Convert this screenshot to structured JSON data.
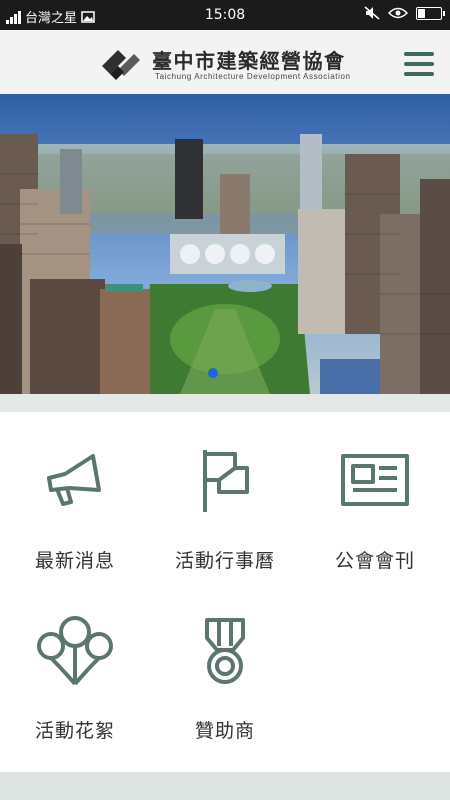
{
  "status_bar": {
    "carrier": "台灣之星",
    "time": "15:08"
  },
  "header": {
    "title_zh": "臺中市建築經營協會",
    "title_en": "Taichung Architecture Development Association",
    "accent_color": "#3f6b5f"
  },
  "hero": {
    "active_slide": 1,
    "indicator_color": "#1e63e0"
  },
  "menu": {
    "items": [
      {
        "label": "最新消息",
        "icon": "megaphone-icon"
      },
      {
        "label": "活動行事曆",
        "icon": "flag-icon"
      },
      {
        "label": "公會會刊",
        "icon": "newspaper-icon"
      },
      {
        "label": "活動花絮",
        "icon": "balloons-icon"
      },
      {
        "label": "贊助商",
        "icon": "medal-icon"
      }
    ],
    "icon_color": "#5c7570"
  }
}
